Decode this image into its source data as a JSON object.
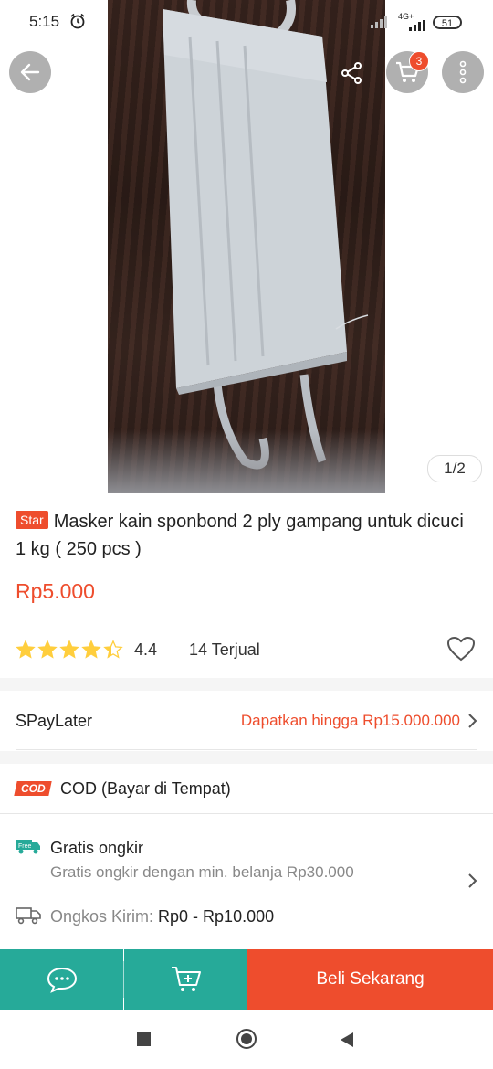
{
  "status_bar": {
    "time": "5:15",
    "network": "4G+",
    "battery": "51"
  },
  "header": {
    "cart_count": "3",
    "image_pager": "1/2"
  },
  "product": {
    "badge": "Star",
    "title": "Masker kain sponbond 2 ply gampang untuk dicuci 1 kg ( 250 pcs )",
    "price": "Rp5.000",
    "rating": "4.4",
    "rating_stars": 4.4,
    "sold": "14 Terjual"
  },
  "spaylater": {
    "label": "SPayLater",
    "value": "Dapatkan hingga Rp15.000.000"
  },
  "cod": {
    "logo": "COD",
    "label": "COD (Bayar di Tempat)"
  },
  "shipping": {
    "free_tag": "Free",
    "title": "Gratis ongkir",
    "subtitle": "Gratis ongkir dengan min. belanja Rp30.000",
    "cost_label": "Ongkos Kirim: ",
    "cost_value": "Rp0 - Rp10.000"
  },
  "actions": {
    "buy_now": "Beli Sekarang"
  },
  "colors": {
    "accent": "#ee4d2d",
    "teal": "#26aa99",
    "star": "#ffce3d"
  }
}
